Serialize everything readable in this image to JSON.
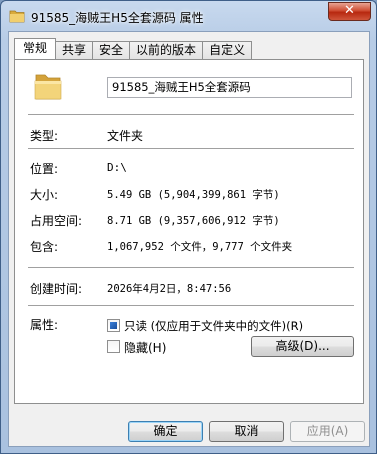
{
  "window": {
    "title": "91585_海贼王H5全套源码 属性",
    "close_glyph": "✕"
  },
  "tabs": [
    {
      "label": "常规",
      "active": true
    },
    {
      "label": "共享"
    },
    {
      "label": "安全"
    },
    {
      "label": "以前的版本"
    },
    {
      "label": "自定义"
    }
  ],
  "general": {
    "name": "91585_海贼王H5全套源码",
    "type_label": "类型:",
    "type_value": "文件夹",
    "location_label": "位置:",
    "location_value": "D:\\",
    "size_label": "大小:",
    "size_value": "5.49 GB (5,904,399,861 字节)",
    "disk_size_label": "占用空间:",
    "disk_size_value": "8.71 GB (9,357,606,912 字节)",
    "contains_label": "包含:",
    "contains_value": "1,067,952 个文件，9,777 个文件夹",
    "created_label": "创建时间:",
    "created_value": "2026年4月2日，8:47:56",
    "attributes_label": "属性:",
    "readonly_label": "只读 (仅应用于文件夹中的文件)(R)",
    "hidden_label": "隐藏(H)",
    "advanced_label": "高级(D)..."
  },
  "footer": {
    "ok_label": "确定",
    "cancel_label": "取消",
    "apply_label": "应用(A)"
  },
  "colors": {
    "folder": "#e8c15a",
    "accent": "#3c7fb1"
  }
}
